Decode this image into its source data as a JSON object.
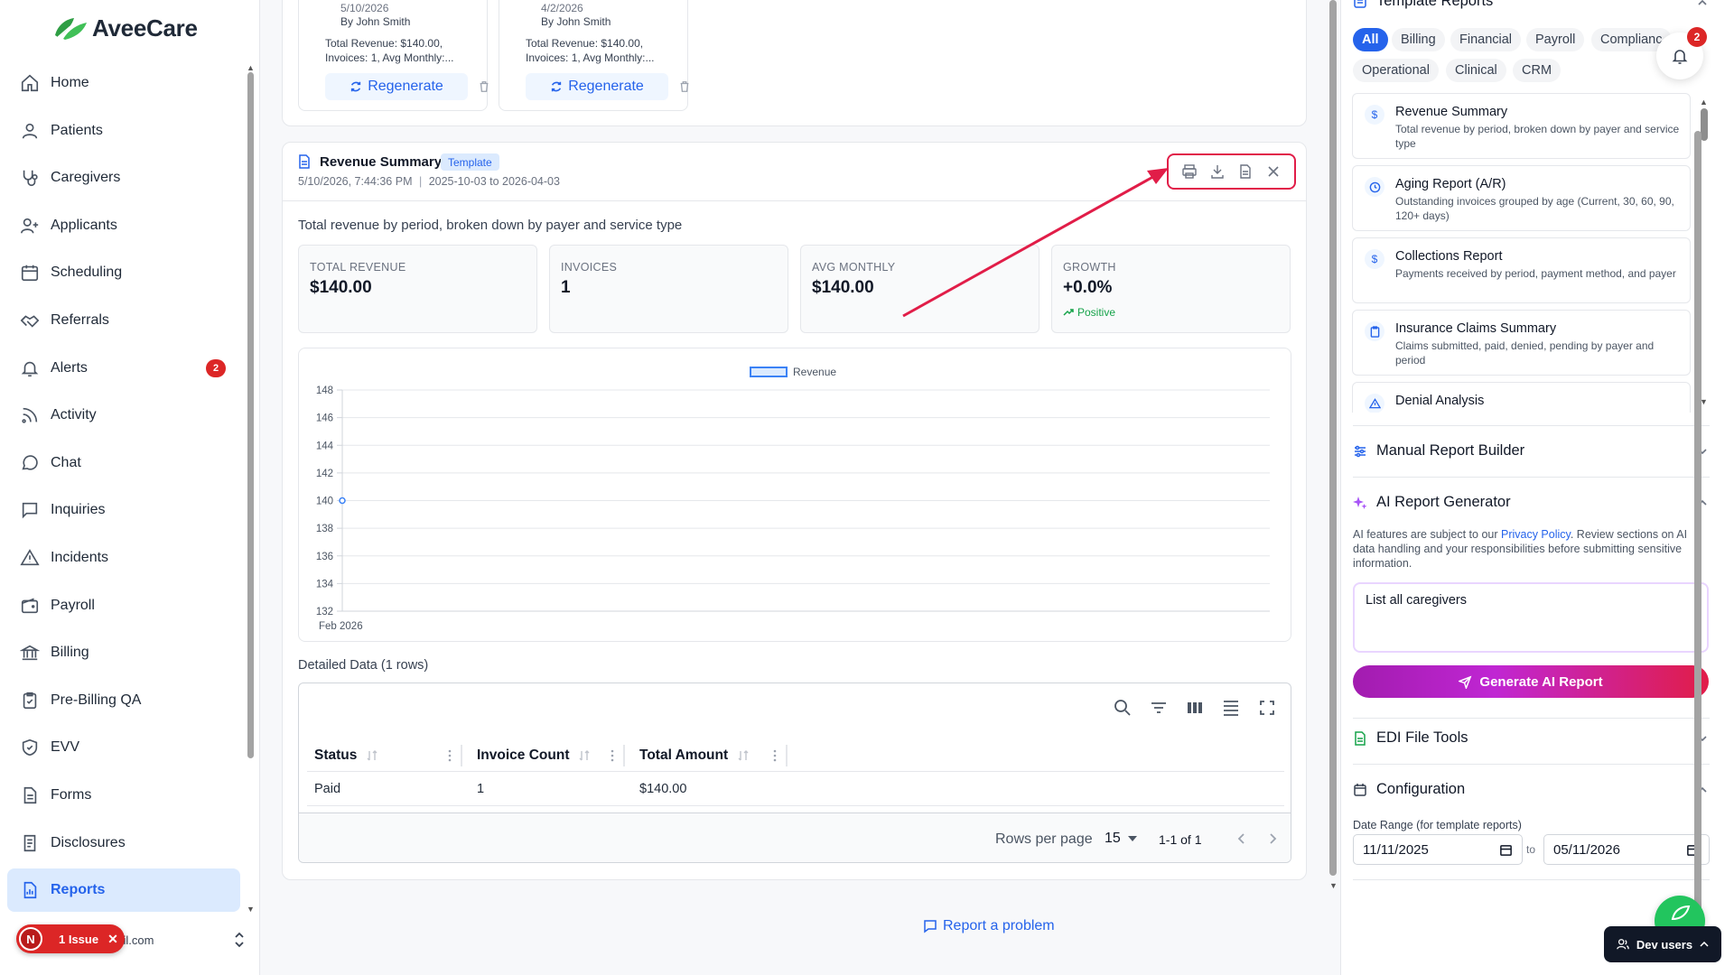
{
  "app": {
    "name": "AveeCare"
  },
  "sidebar": {
    "items": [
      {
        "label": "Home",
        "icon": "home-icon"
      },
      {
        "label": "Patients",
        "icon": "user-icon"
      },
      {
        "label": "Caregivers",
        "icon": "stethoscope-icon"
      },
      {
        "label": "Applicants",
        "icon": "user-plus-icon"
      },
      {
        "label": "Scheduling",
        "icon": "calendar-icon"
      },
      {
        "label": "Referrals",
        "icon": "handshake-icon"
      },
      {
        "label": "Alerts",
        "icon": "bell-icon",
        "badge": "2"
      },
      {
        "label": "Activity",
        "icon": "rss-icon"
      },
      {
        "label": "Chat",
        "icon": "chat-bubble-icon"
      },
      {
        "label": "Inquiries",
        "icon": "message-square-icon"
      },
      {
        "label": "Incidents",
        "icon": "warning-triangle-icon"
      },
      {
        "label": "Payroll",
        "icon": "wallet-icon"
      },
      {
        "label": "Billing",
        "icon": "bank-icon"
      },
      {
        "label": "Pre-Billing QA",
        "icon": "clipboard-check-icon"
      },
      {
        "label": "EVV",
        "icon": "shield-check-icon"
      },
      {
        "label": "Forms",
        "icon": "file-text-icon"
      },
      {
        "label": "Disclosures",
        "icon": "file-list-icon"
      },
      {
        "label": "Reports",
        "icon": "file-chart-icon",
        "active": true
      }
    ],
    "user_email": "@gmail.com",
    "issue": {
      "initial": "N",
      "label": "1 Issue"
    }
  },
  "top_cards": [
    {
      "date": "5/10/2026",
      "by": "By John Smith",
      "summary_line1": "Total Revenue: $140.00,",
      "summary_line2": "Invoices: 1, Avg Monthly:...",
      "button": "Regenerate"
    },
    {
      "date": "4/2/2026",
      "by": "By John Smith",
      "summary_line1": "Total Revenue: $140.00,",
      "summary_line2": "Invoices: 1, Avg Monthly:...",
      "button": "Regenerate"
    }
  ],
  "report": {
    "title": "Revenue Summary",
    "tag": "Template",
    "generated": "5/10/2026, 7:44:36 PM",
    "range": "2025-10-03 to 2026-04-03",
    "description": "Total revenue by period, broken down by payer and service type",
    "stats": [
      {
        "label": "TOTAL REVENUE",
        "value": "$140.00"
      },
      {
        "label": "INVOICES",
        "value": "1"
      },
      {
        "label": "AVG MONTHLY",
        "value": "$140.00"
      },
      {
        "label": "GROWTH",
        "value": "+0.0%",
        "trend": "Positive"
      }
    ],
    "detail_label": "Detailed Data (1 rows)",
    "table": {
      "columns": [
        "Status",
        "Invoice Count",
        "Total Amount"
      ],
      "rows": [
        [
          "Paid",
          "1",
          "$140.00"
        ]
      ]
    },
    "pagination": {
      "rows_per_page_label": "Rows per page",
      "rows_per_page": "15",
      "range": "1-1 of 1"
    }
  },
  "chart_data": {
    "type": "line",
    "x": [
      "Feb 2026"
    ],
    "series": [
      {
        "name": "Revenue",
        "values": [
          140
        ],
        "color": "#3b82f6"
      }
    ],
    "yticks": [
      132,
      134,
      136,
      138,
      140,
      142,
      144,
      146,
      148
    ],
    "ylim": [
      132,
      148
    ],
    "legend": "top-center",
    "grid": true
  },
  "footer": {
    "report_problem": "Report a problem"
  },
  "right_panel": {
    "template_reports": {
      "title": "Template Reports",
      "filters": [
        "All",
        "Billing",
        "Financial",
        "Payroll",
        "Complianc",
        "Operational",
        "Clinical",
        "CRM"
      ],
      "active_filter": "All",
      "items": [
        {
          "name": "Revenue Summary",
          "desc": "Total revenue by period, broken down by payer and service type",
          "icon": "dollar-icon"
        },
        {
          "name": "Aging Report (A/R)",
          "desc": "Outstanding invoices grouped by age (Current, 30, 60, 90, 120+ days)",
          "icon": "clock-icon"
        },
        {
          "name": "Collections Report",
          "desc": "Payments received by period, payment method, and payer",
          "icon": "dollar-icon"
        },
        {
          "name": "Insurance Claims Summary",
          "desc": "Claims submitted, paid, denied, pending by payer and period",
          "icon": "clipboard-icon"
        },
        {
          "name": "Denial Analysis",
          "desc": "",
          "icon": "warning-icon"
        }
      ]
    },
    "manual_builder": {
      "title": "Manual Report Builder"
    },
    "ai_generator": {
      "title": "AI Report Generator",
      "note_pre": "AI features are subject to our ",
      "note_link": "Privacy Policy",
      "note_post": ". Review sections on AI data handling and your responsibilities before submitting sensitive information.",
      "prompt": "List all caregivers",
      "button": "Generate AI Report"
    },
    "edi_tools": {
      "title": "EDI File Tools"
    },
    "configuration": {
      "title": "Configuration",
      "date_label": "Date Range (for template reports)",
      "from": "11/11/2025",
      "to_label": "to",
      "to": "05/11/2026"
    },
    "notifications_badge": "2",
    "dev_users": "Dev users"
  },
  "colors": {
    "primary": "#2563eb",
    "danger": "#dc2626",
    "success": "#16a34a",
    "highlight": "#e11d48"
  }
}
